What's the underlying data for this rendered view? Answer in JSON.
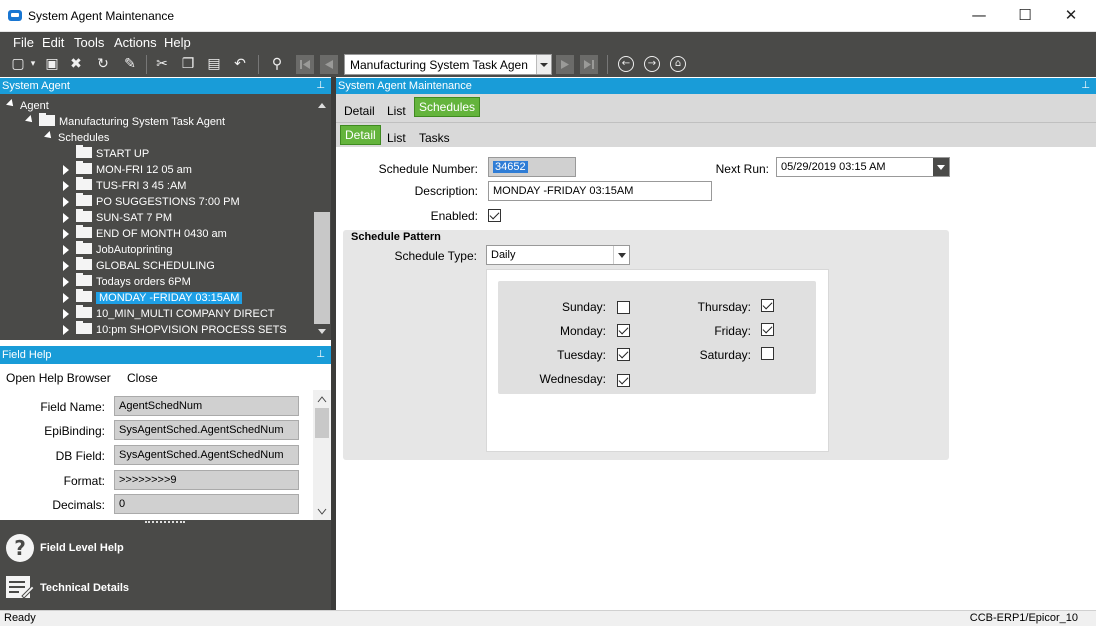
{
  "window": {
    "title": "System Agent Maintenance",
    "minimize": "—",
    "maximize": "☐",
    "close": "✕"
  },
  "menu": [
    "File",
    "Edit",
    "Tools",
    "Actions",
    "Help"
  ],
  "toolbar": {
    "task_combo_value": "Manufacturing System Task Agen"
  },
  "tree_panel": {
    "title": "System Agent",
    "root": "Agent",
    "agent": "Manufacturing System Task Agent",
    "group": "Schedules",
    "schedules": [
      "START UP",
      "MON-FRI 12 05 am",
      "TUS-FRI 3 45 :AM",
      "PO SUGGESTIONS 7:00 PM",
      "SUN-SAT  7 PM",
      "END OF MONTH 0430 am",
      "JobAutoprinting",
      "GLOBAL SCHEDULING",
      "Todays orders 6PM",
      "MONDAY -FRIDAY 03:15AM",
      "10_MIN_MULTI COMPANY DIRECT",
      "10:pm SHOPVISION PROCESS SETS"
    ]
  },
  "field_help": {
    "title": "Field Help",
    "open_browser": "Open Help Browser",
    "close": "Close",
    "rows": [
      {
        "label": "Field Name:",
        "value": "AgentSchedNum"
      },
      {
        "label": "EpiBinding:",
        "value": "SysAgentSched.AgentSchedNum"
      },
      {
        "label": "DB Field:",
        "value": "SysAgentSched.AgentSchedNum"
      },
      {
        "label": "Format:",
        "value": ">>>>>>>>9"
      },
      {
        "label": "Decimals:",
        "value": "0"
      }
    ],
    "field_level_help": "Field Level Help",
    "technical_details": "Technical Details"
  },
  "main": {
    "title": "System Agent Maintenance",
    "tabs1": [
      "Detail",
      "List",
      "Schedules"
    ],
    "tabs2": [
      "Detail",
      "List",
      "Tasks"
    ],
    "schedule_number_label": "Schedule Number:",
    "schedule_number": "34652",
    "next_run_label": "Next Run:",
    "next_run": "05/29/2019 03:15 AM",
    "description_label": "Description:",
    "description": "MONDAY -FRIDAY 03:15AM",
    "enabled_label": "Enabled:",
    "pattern_title": "Schedule Pattern",
    "schedule_type_label": "Schedule Type:",
    "schedule_type": "Daily",
    "days": {
      "sunday": "Sunday:",
      "monday": "Monday:",
      "tuesday": "Tuesday:",
      "wednesday": "Wednesday:",
      "thursday": "Thursday:",
      "friday": "Friday:",
      "saturday": "Saturday:"
    }
  },
  "status": {
    "left": "Ready",
    "right": "CCB-ERP1/Epicor_10"
  }
}
